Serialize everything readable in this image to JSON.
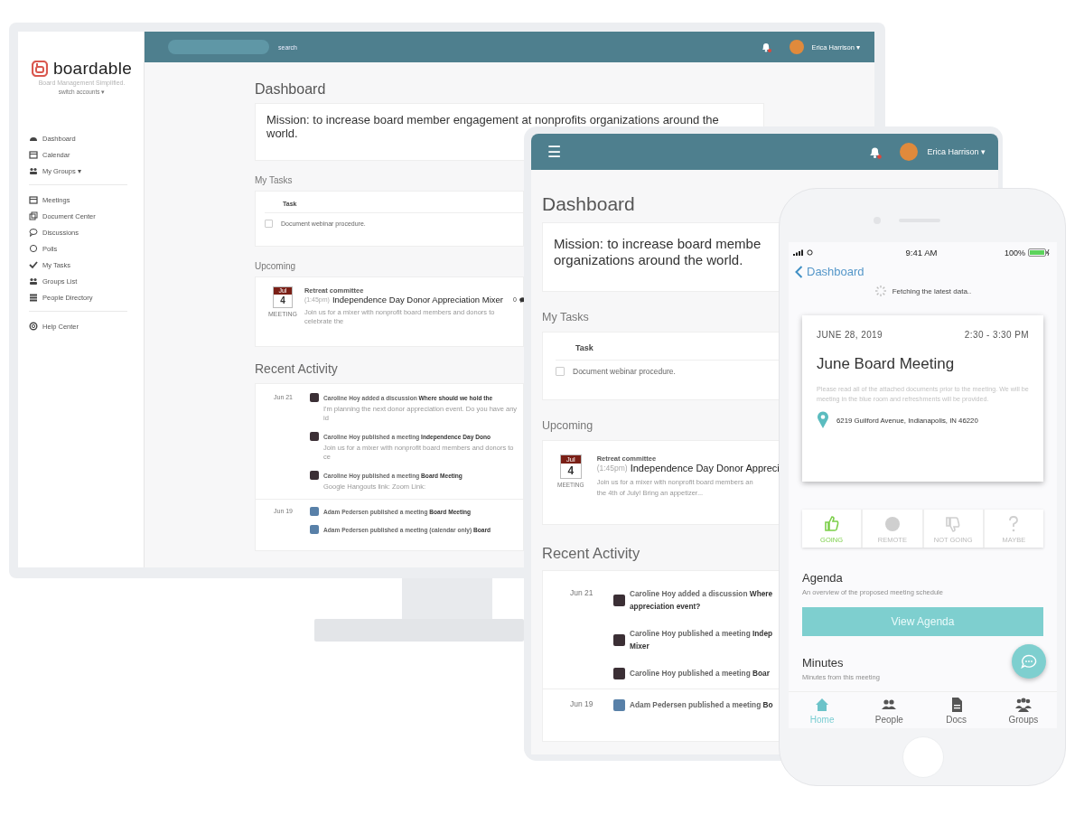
{
  "desktop": {
    "topbar": {
      "search_label": "search",
      "user": "Erica Harrison",
      "caret": "▾"
    },
    "logo": {
      "name": "boardable",
      "tagline": "Board Management Simplified.",
      "switch": "switch accounts ▾"
    },
    "nav": [
      {
        "items": [
          {
            "label": "Dashboard"
          },
          {
            "label": "Calendar"
          },
          {
            "label": "My Groups ▾"
          }
        ]
      },
      {
        "items": [
          {
            "label": "Meetings"
          },
          {
            "label": "Document Center"
          },
          {
            "label": "Discussions"
          },
          {
            "label": "Polls"
          },
          {
            "label": "My Tasks"
          },
          {
            "label": "Groups List"
          },
          {
            "label": "People Directory"
          }
        ]
      },
      {
        "items": [
          {
            "label": "Help Center"
          }
        ]
      }
    ],
    "title": "Dashboard",
    "mission": "Mission: to increase board member engagement at nonprofits organizations around the world.",
    "tasks": {
      "heading": "My Tasks",
      "column": "Task",
      "rows": [
        {
          "label": "Document webinar procedure.",
          "checked": false
        }
      ]
    },
    "upcoming": {
      "heading": "Upcoming",
      "events": [
        {
          "month": "Jul",
          "day": "4",
          "type": "MEETING",
          "group": "Retreat committee",
          "time": "(1:45pm)",
          "title": "Independence Day Donor Appreciation Mixer",
          "comments": "0",
          "description": "Join us for a mixer with nonprofit board members and donors to celebrate the"
        }
      ]
    },
    "activity": {
      "heading": "Recent Activity",
      "days": [
        {
          "date": "Jun 21",
          "items": [
            {
              "text": "Caroline Hoy added a discussion **Where should we hold the**",
              "detail": "I'm planning the next donor appreciation event. Do you have any id"
            },
            {
              "text": "Caroline Hoy published a meeting **Independence Day Dono**",
              "detail": "Join us for a mixer with nonprofit board members and donors to ce"
            },
            {
              "text": "Caroline Hoy published a meeting **Board Meeting**",
              "detail": "Google Hangouts link: Zoom Link:"
            }
          ]
        },
        {
          "date": "Jun 19",
          "items": [
            {
              "text": "Adam Pedersen published a meeting **Board Meeting**"
            },
            {
              "text": "Adam Pedersen published a meeting (calendar only) **Board**"
            }
          ]
        }
      ]
    }
  },
  "tablet": {
    "menu": "☰",
    "user": "Erica Harrison",
    "caret": "▾",
    "title": "Dashboard",
    "mission": "Mission: to increase board membe\norganizations around the world.",
    "tasks": {
      "heading": "My Tasks",
      "column": "Task",
      "rows": [
        {
          "label": "Document webinar procedure.",
          "checked": false
        }
      ]
    },
    "upcoming": {
      "heading": "Upcoming",
      "events": [
        {
          "month": "Jul",
          "day": "4",
          "type": "MEETING",
          "group": "Retreat committee",
          "time": "(1:45pm)",
          "title": "Independence Day Donor Appreci",
          "description": "Join us for a mixer with nonprofit board members an\nthe 4th of July! Bring an appetizer..."
        }
      ]
    },
    "activity": {
      "heading": "Recent Activity",
      "days": [
        {
          "date": "Jun 21",
          "items": [
            {
              "text": "Caroline Hoy added a discussion **Where**\n**appreciation event?**"
            },
            {
              "text": "Caroline Hoy published a meeting **Indep**\n**Mixer**"
            },
            {
              "text": "Caroline Hoy published a meeting **Boar**"
            }
          ]
        },
        {
          "date": "Jun 19",
          "items": [
            {
              "text": "Adam Pedersen published a meeting **Bo**"
            }
          ]
        }
      ]
    }
  },
  "phone": {
    "status": {
      "time": "9:41 AM",
      "battery": "100%"
    },
    "back": "Dashboard",
    "loading": "Fetching the latest data..",
    "meeting": {
      "date": "JUNE 28, 2019",
      "time": "2:30 - 3:30 PM",
      "title": "June Board Meeting",
      "description": "Please read all of the attached documents prior to the meeting. We will be meeting in the blue room and refreshments will be provided.",
      "address": "6219 Guilford Avenue, Indianapolis, IN 46220"
    },
    "rsvp": [
      {
        "label": "GOING",
        "selected": true
      },
      {
        "label": "REMOTE",
        "selected": false
      },
      {
        "label": "NOT GOING",
        "selected": false
      },
      {
        "label": "MAYBE",
        "selected": false
      }
    ],
    "agenda": {
      "heading": "Agenda",
      "subtitle": "An overview of the proposed meeting schedule",
      "button": "View Agenda"
    },
    "minutes": {
      "heading": "Minutes",
      "subtitle": "Minutes from this meeting"
    },
    "tabs": [
      {
        "label": "Home",
        "selected": true
      },
      {
        "label": "People",
        "selected": false
      },
      {
        "label": "Docs",
        "selected": false
      },
      {
        "label": "Groups",
        "selected": false
      }
    ]
  }
}
